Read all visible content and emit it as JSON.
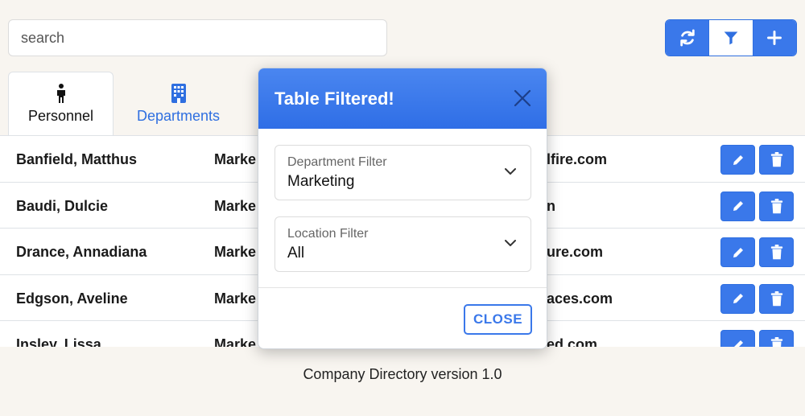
{
  "search": {
    "placeholder": "search"
  },
  "toolbar": {
    "refresh_icon": "refresh-icon",
    "filter_icon": "filter-icon",
    "add_icon": "plus-icon",
    "accent": "#3a78ea"
  },
  "tabs": [
    {
      "label": "Personnel",
      "icon": "person-icon",
      "active": true
    },
    {
      "label": "Departments",
      "icon": "building-icon",
      "active": false
    }
  ],
  "rows": [
    {
      "name": "Banfield, Matthus",
      "department": "Marke",
      "email": "lfire.com"
    },
    {
      "name": "Baudi, Dulcie",
      "department": "Marke",
      "email": "n"
    },
    {
      "name": "Drance, Annadiana",
      "department": "Marke",
      "email": "ure.com"
    },
    {
      "name": "Edgson, Aveline",
      "department": "Marke",
      "email": "aces.com"
    },
    {
      "name": "Insley, Lissa",
      "department": "Marke",
      "email": "ed.com"
    }
  ],
  "footer": {
    "text": "Company Directory version 1.0"
  },
  "modal": {
    "title": "Table Filtered!",
    "department_filter": {
      "label": "Department Filter",
      "value": "Marketing"
    },
    "location_filter": {
      "label": "Location Filter",
      "value": "All"
    },
    "close_label": "CLOSE"
  }
}
